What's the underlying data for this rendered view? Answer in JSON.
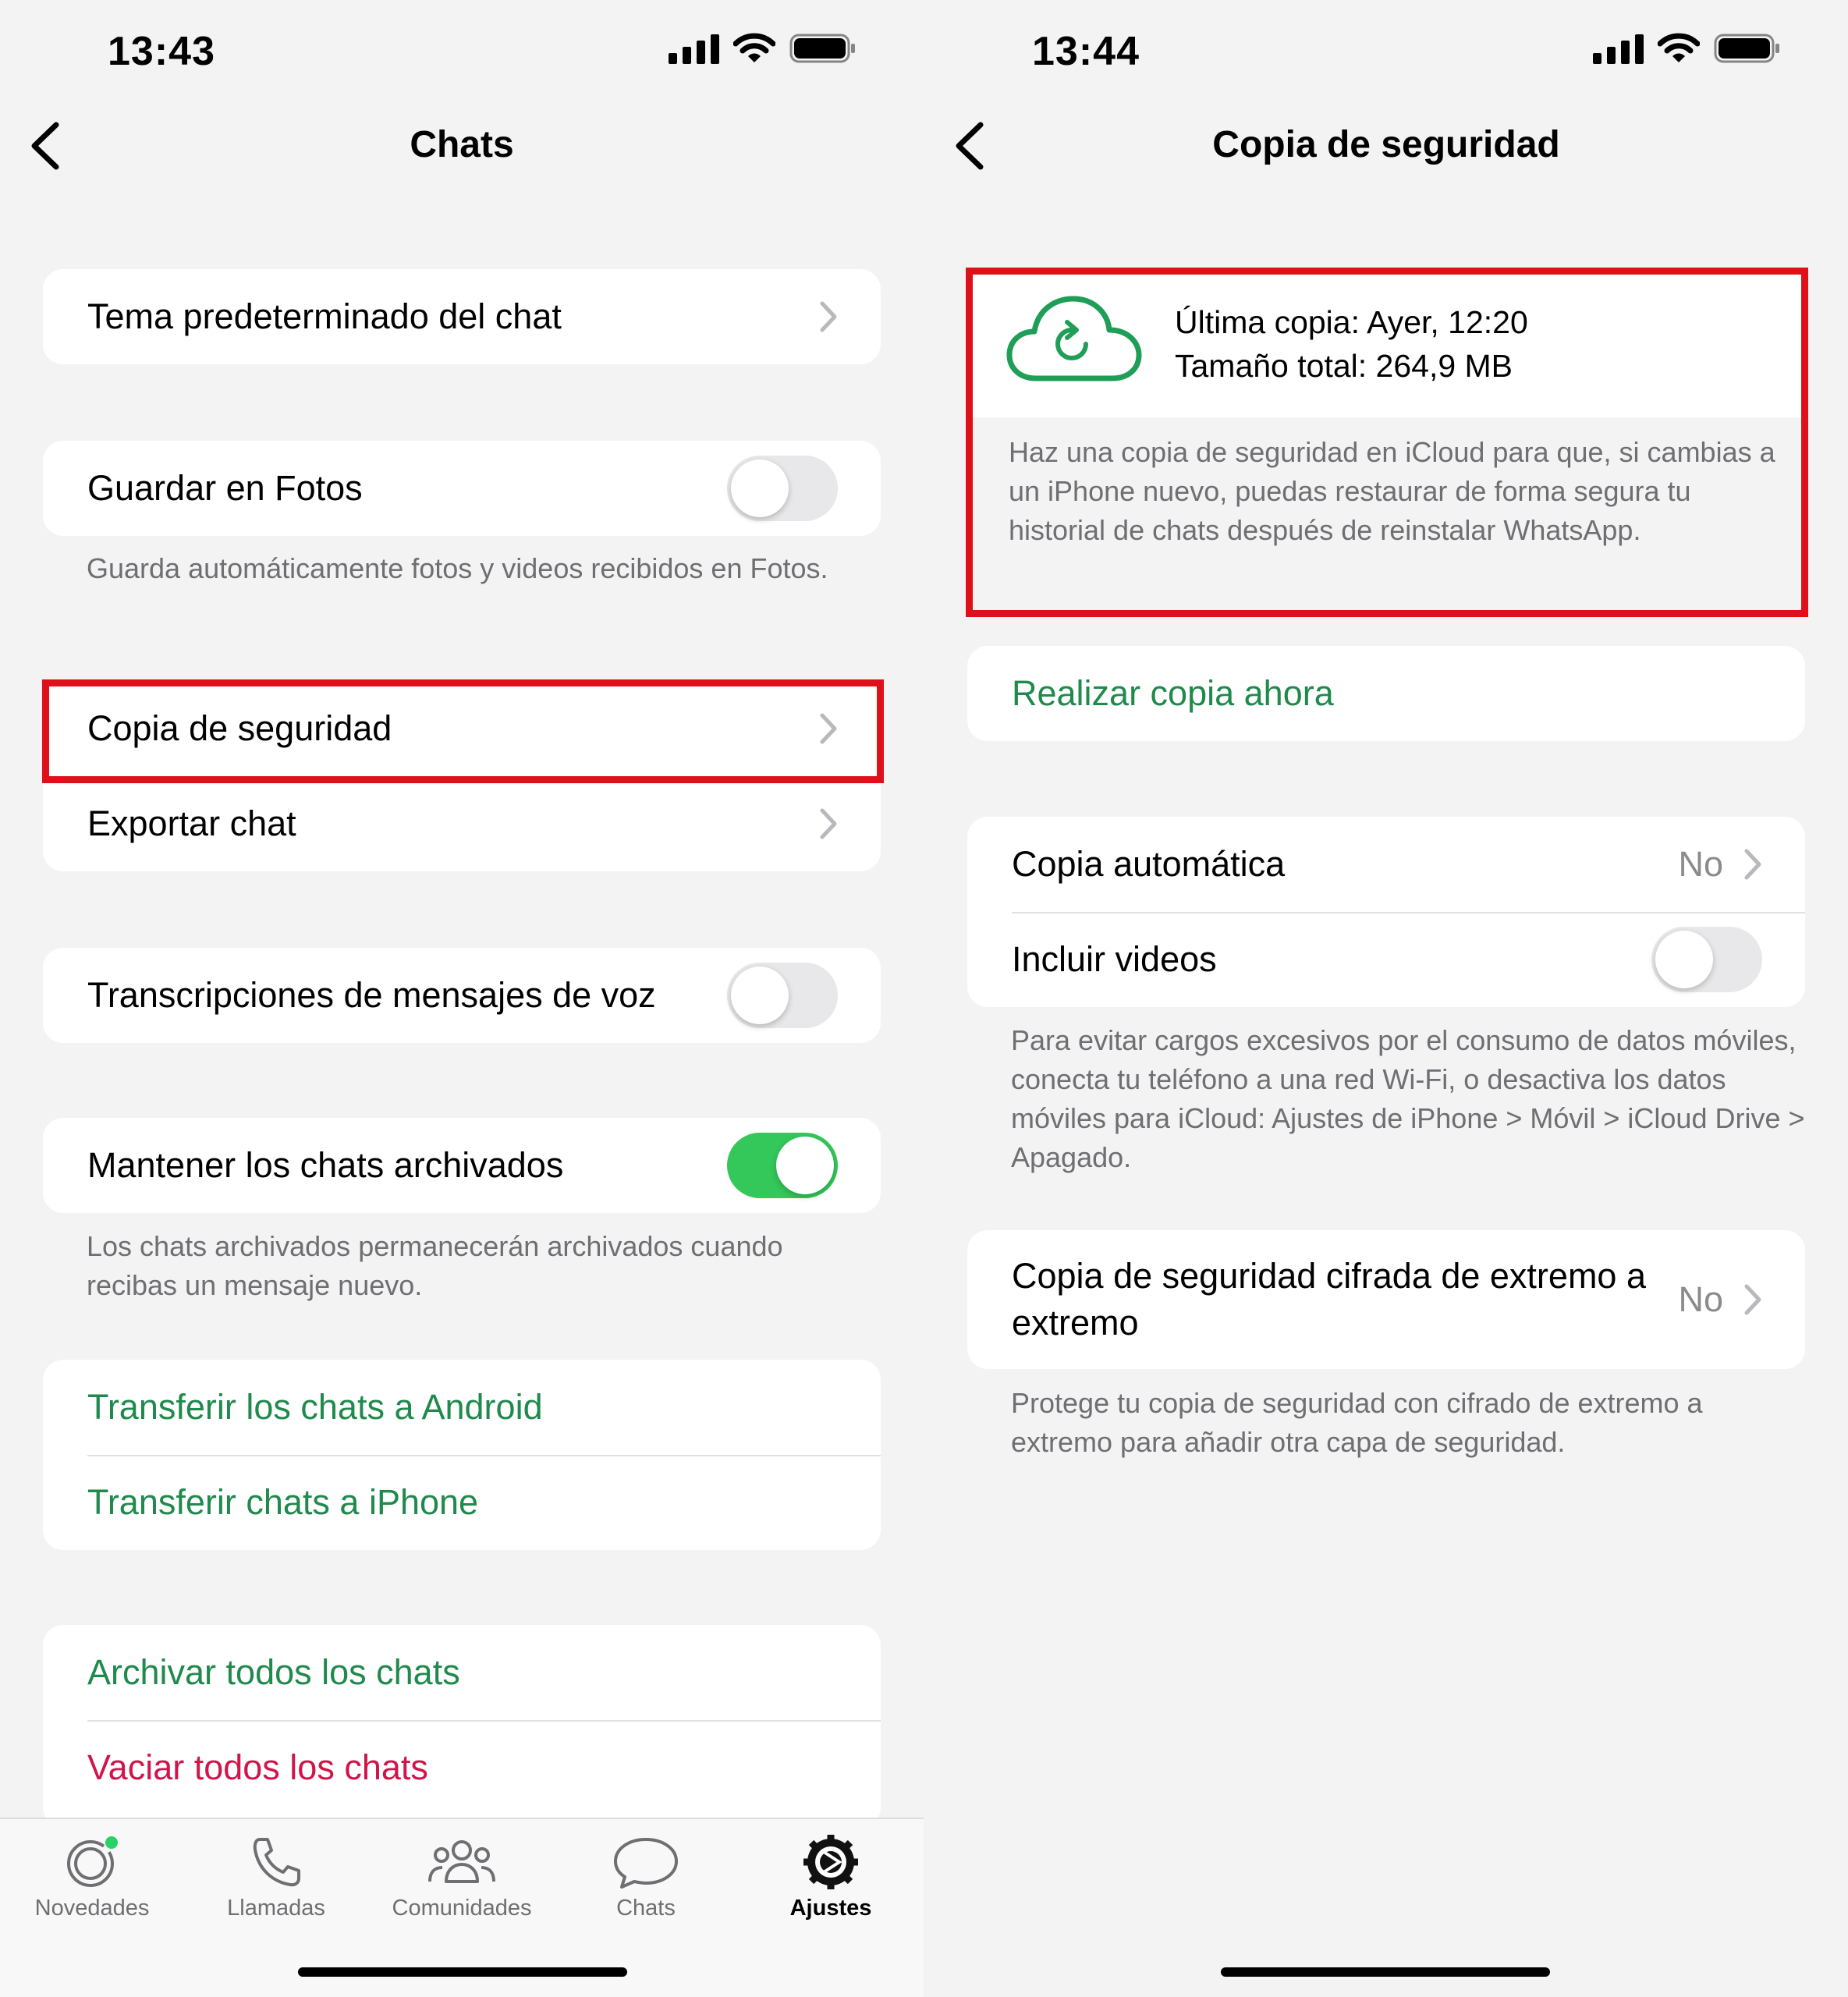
{
  "left": {
    "status_time": "13:43",
    "title": "Chats",
    "items": {
      "theme": "Tema predeterminado del chat",
      "save_photos": "Guardar en Fotos",
      "save_photos_note": "Guarda automáticamente fotos y videos recibidos en Fotos.",
      "backup": "Copia de seguridad",
      "export": "Exportar chat",
      "transcriptions": "Transcripciones de mensajes de voz",
      "keep_archived": "Mantener los chats archivados",
      "keep_archived_note": "Los chats archivados permanecerán archivados cuando recibas un mensaje nuevo.",
      "transfer_android": "Transferir los chats a Android",
      "transfer_iphone": "Transferir chats a iPhone",
      "archive_all": "Archivar todos los chats",
      "clear_all": "Vaciar todos los chats"
    },
    "toggles": {
      "save_photos": false,
      "transcriptions": false,
      "keep_archived": true
    },
    "tabs": [
      "Novedades",
      "Llamadas",
      "Comunidades",
      "Chats",
      "Ajustes"
    ],
    "active_tab": "Ajustes"
  },
  "right": {
    "status_time": "13:44",
    "title": "Copia de seguridad",
    "last_backup": "Última copia: Ayer, 12:20",
    "total_size": "Tamaño total: 264,9 MB",
    "backup_description": "Haz una copia de seguridad en iCloud para que, si cambias a un iPhone nuevo, puedas restaurar de forma segura tu historial de chats después de reinstalar WhatsApp.",
    "backup_now": "Realizar copia ahora",
    "auto_backup": "Copia automática",
    "auto_backup_value": "No",
    "include_videos": "Incluir videos",
    "include_videos_on": false,
    "data_note": "Para evitar cargos excesivos por el consumo de datos móviles, conecta tu teléfono a una red Wi-Fi, o desactiva los datos móviles para iCloud: Ajustes de iPhone > Móvil > iCloud Drive > Apagado.",
    "e2e_backup": "Copia de seguridad cifrada de extremo a extremo",
    "e2e_value": "No",
    "e2e_note": "Protege tu copia de seguridad con cifrado de extremo a extremo para añadir otra capa de seguridad."
  },
  "colors": {
    "accent_green": "#1f8a4c",
    "destructive_red": "#d0154a",
    "toggle_on": "#34c759",
    "highlight": "#e0101b"
  },
  "icons": [
    "cellular-signal-icon",
    "wifi-icon",
    "battery-icon",
    "back-chevron-icon",
    "chevron-right-icon",
    "icloud-sync-icon",
    "status-icon",
    "phone-icon",
    "communities-icon",
    "chats-icon",
    "settings-gear-icon"
  ]
}
